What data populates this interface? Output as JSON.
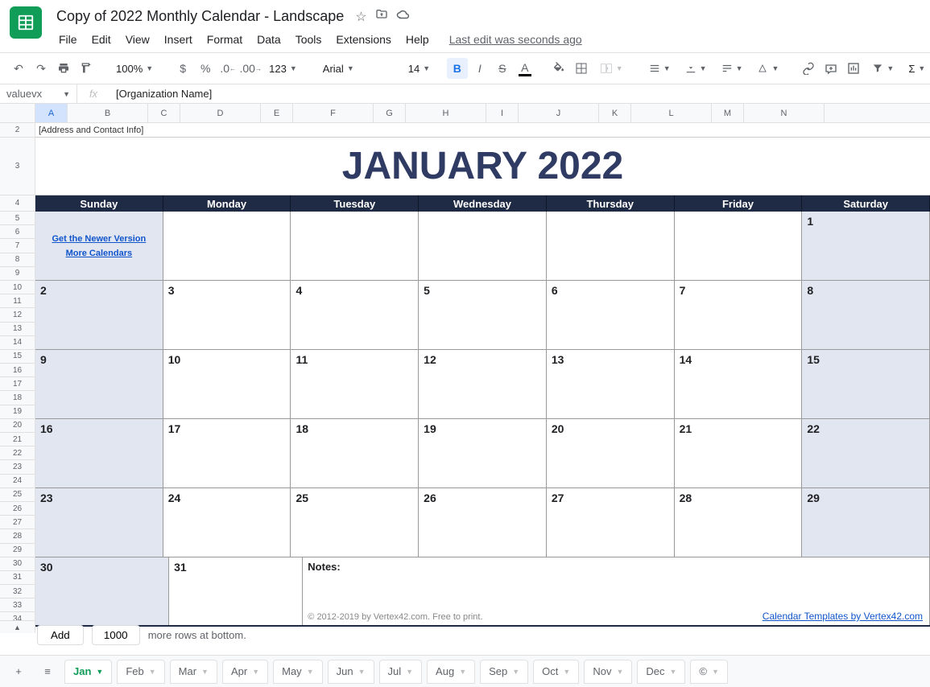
{
  "doc": {
    "title": "Copy of 2022 Monthly Calendar - Landscape",
    "last_edit": "Last edit was seconds ago"
  },
  "menus": [
    "File",
    "Edit",
    "View",
    "Insert",
    "Format",
    "Data",
    "Tools",
    "Extensions",
    "Help"
  ],
  "toolbar": {
    "zoom": "100%",
    "font": "Arial",
    "font_size": "14"
  },
  "name_box": "valuevx",
  "formula": "[Organization Name]",
  "columns": [
    {
      "l": "A",
      "w": 40
    },
    {
      "l": "B",
      "w": 100
    },
    {
      "l": "C",
      "w": 40
    },
    {
      "l": "D",
      "w": 100
    },
    {
      "l": "E",
      "w": 40
    },
    {
      "l": "F",
      "w": 100
    },
    {
      "l": "G",
      "w": 40
    },
    {
      "l": "H",
      "w": 100
    },
    {
      "l": "I",
      "w": 40
    },
    {
      "l": "J",
      "w": 100
    },
    {
      "l": "K",
      "w": 40
    },
    {
      "l": "L",
      "w": 100
    },
    {
      "l": "M",
      "w": 40
    },
    {
      "l": "N",
      "w": 100
    }
  ],
  "row_headers": [
    "2",
    "3",
    "4",
    "5",
    "6",
    "7",
    "8",
    "9",
    "10",
    "11",
    "12",
    "13",
    "14",
    "15",
    "16",
    "17",
    "18",
    "19",
    "20",
    "21",
    "22",
    "23",
    "24",
    "25",
    "26",
    "27",
    "28",
    "29",
    "30",
    "31",
    "32",
    "33",
    "34"
  ],
  "calendar": {
    "address": "[Address and Contact Info]",
    "title": "JANUARY 2022",
    "dow": [
      "Sunday",
      "Monday",
      "Tuesday",
      "Wednesday",
      "Thursday",
      "Friday",
      "Saturday"
    ],
    "link1": "Get the Newer Version",
    "link2": "More Calendars",
    "weeks": [
      [
        "",
        "",
        "",
        "",
        "",
        "",
        "1"
      ],
      [
        "2",
        "3",
        "4",
        "5",
        "6",
        "7",
        "8"
      ],
      [
        "9",
        "10",
        "11",
        "12",
        "13",
        "14",
        "15"
      ],
      [
        "16",
        "17",
        "18",
        "19",
        "20",
        "21",
        "22"
      ],
      [
        "23",
        "24",
        "25",
        "26",
        "27",
        "28",
        "29"
      ],
      [
        "30",
        "31"
      ]
    ],
    "notes_label": "Notes:",
    "copyright": "© 2012-2019 by Vertex42.com. Free to print.",
    "template_link": "Calendar Templates by Vertex42.com"
  },
  "add_rows": {
    "btn": "Add",
    "count": "1000",
    "suffix": "more rows at bottom."
  },
  "tabs": [
    "Jan",
    "Feb",
    "Mar",
    "Apr",
    "May",
    "Jun",
    "Jul",
    "Aug",
    "Sep",
    "Oct",
    "Nov",
    "Dec",
    "©"
  ],
  "active_tab": 0
}
